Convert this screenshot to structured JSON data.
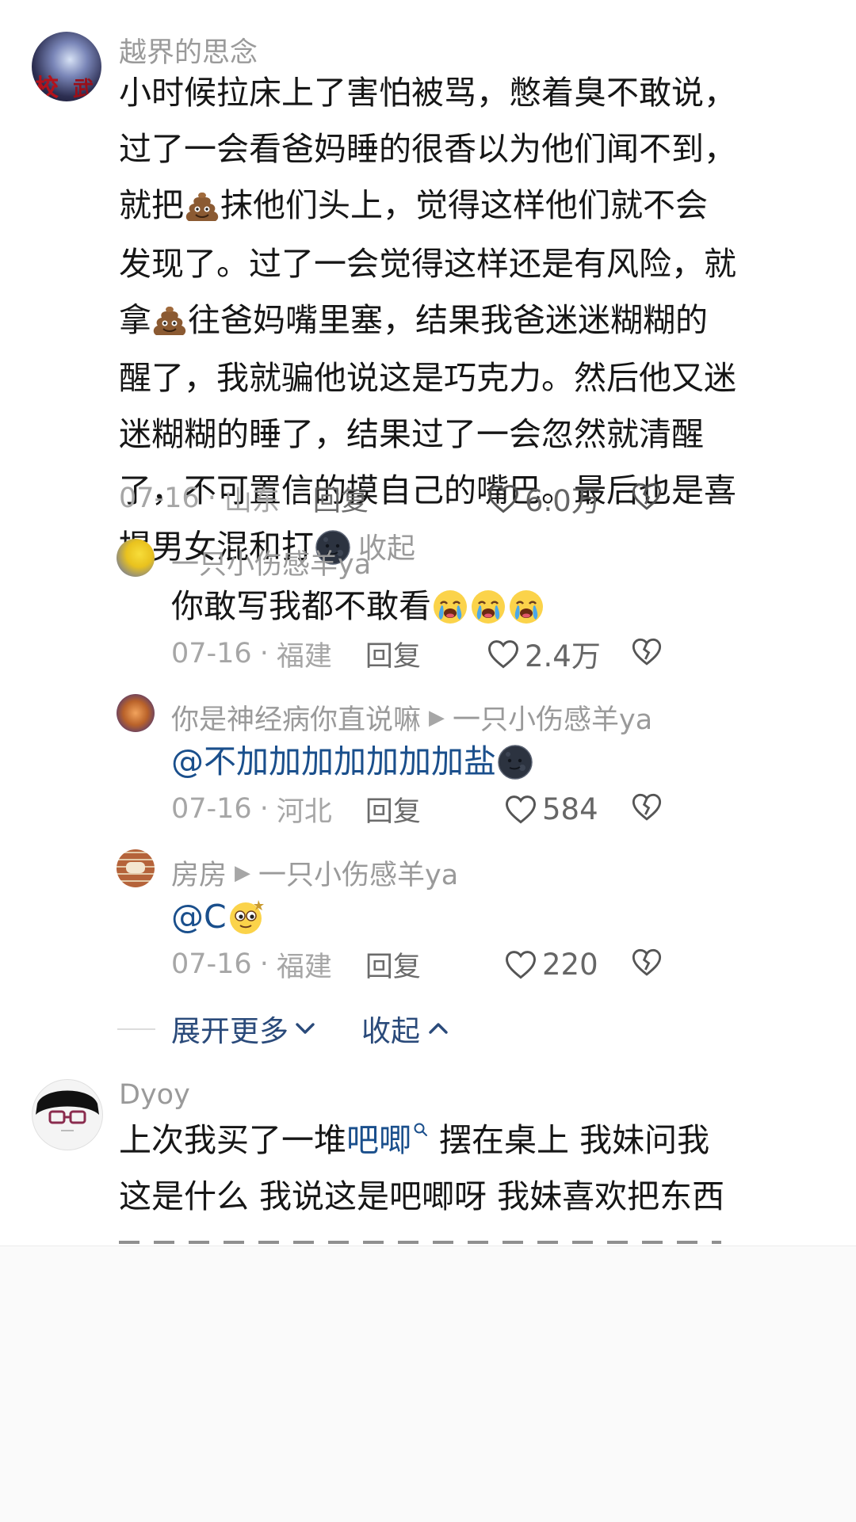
{
  "main_comment": {
    "username": "越界的思念",
    "lines": [
      [
        "小时候拉床上了害怕被骂，憋着臭不敢说，"
      ],
      [
        "过了一会看爸妈睡的很香以为他们闻不到，"
      ],
      [
        "就把",
        "{poop}",
        "抹他们头上，觉得这样他们就不会"
      ],
      [
        "发现了。过了一会觉得这样还是有风险，就"
      ],
      [
        "拿",
        "{poop}",
        "往爸妈嘴里塞，结果我爸迷迷糊糊的"
      ],
      [
        "醒了，我就骗他说这是巧克力。然后他又迷"
      ],
      [
        "迷糊糊的睡了，结果过了一会忽然就清醒"
      ],
      [
        "了，不可置信的摸自己的嘴巴。最后也是喜"
      ]
    ],
    "last_line_text": "提男女混和打",
    "collapse_label": "收起",
    "date": "07-16",
    "location": "山东",
    "reply_label": "回复",
    "likes": "6.0万"
  },
  "replies": [
    {
      "username": "一只小伤感羊ya",
      "text": "你敢写我都不敢看",
      "date": "07-16",
      "location": "福建",
      "reply_label": "回复",
      "likes": "2.4万"
    },
    {
      "username": "你是神经病你直说嘛",
      "reply_to": "一只小伤感羊ya",
      "text": "@不加加加加加加加盐",
      "date": "07-16",
      "location": "河北",
      "reply_label": "回复",
      "likes": "584"
    },
    {
      "username": "房房",
      "reply_to": "一只小伤感羊ya",
      "text": "@C",
      "date": "07-16",
      "location": "福建",
      "reply_label": "回复",
      "likes": "220"
    }
  ],
  "thread_controls": {
    "expand_label": "展开更多",
    "collapse_label": "收起"
  },
  "second_comment": {
    "username": "Dyoy",
    "line1_before": "上次我买了一堆",
    "line1_link": "吧唧",
    "line1_after": " 摆在桌上 我妹问我",
    "line2": "这是什么 我说这是吧唧呀 我妹喜欢把东西"
  },
  "colors": {
    "link": "#1a4f8c",
    "meta_gray": "#a6a6a6",
    "name_gray": "#9a9a9a"
  },
  "icons": [
    "poop-emoji",
    "moon-face-emoji",
    "crying-face-emoji",
    "dizzy-face-emoji",
    "heart-outline-icon",
    "broken-heart-icon",
    "chevron-down-icon",
    "chevron-up-icon",
    "search-icon",
    "play-arrow-icon"
  ]
}
